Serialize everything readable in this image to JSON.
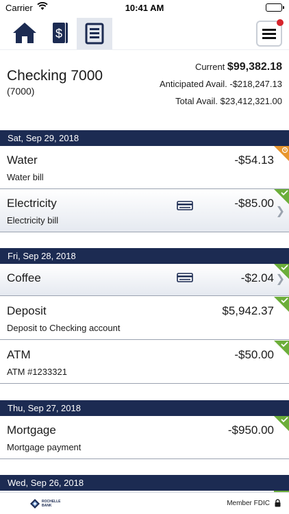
{
  "status_bar": {
    "carrier": "Carrier",
    "time": "10:41 AM"
  },
  "nav": {
    "tabs": [
      {
        "icon": "home-icon",
        "selected": false
      },
      {
        "icon": "money-icon",
        "selected": false
      },
      {
        "icon": "register-icon",
        "selected": true
      }
    ],
    "menu_icon": "menu-icon",
    "menu_has_notification": true
  },
  "account": {
    "name": "Checking 7000",
    "number": "(7000)",
    "current_label": "Current",
    "current_value": "$99,382.18",
    "anticipated": "Anticipated Avail. -$218,247.13",
    "total": "Total Avail. $23,412,321.00"
  },
  "dates": [
    "Sat, Sep 29, 2018",
    "Fri, Sep 28, 2018",
    "Thu, Sep 27, 2018",
    "Wed, Sep 26, 2018"
  ],
  "transactions": [
    {
      "title": "Water",
      "amount": "-$54.13",
      "description": "Water bill",
      "status": "pending"
    },
    {
      "title": "Electricity",
      "amount": "-$85.00",
      "description": "Electricity bill",
      "status": "cleared",
      "card": true
    },
    {
      "title": "Coffee",
      "amount": "-$2.04",
      "description": "",
      "status": "cleared",
      "card": true
    },
    {
      "title": "Deposit",
      "amount": "$5,942.37",
      "description": "Deposit to Checking account",
      "status": "cleared"
    },
    {
      "title": "ATM",
      "amount": "-$50.00",
      "description": "ATM #1233321",
      "status": "cleared"
    },
    {
      "title": "Mortgage",
      "amount": "-$950.00",
      "description": "Mortgage payment",
      "status": "cleared"
    }
  ],
  "colors": {
    "navy": "#1c2b52",
    "cleared": "#6cae3a",
    "pending": "#e8962e",
    "badge": "#d6242c"
  },
  "footer": {
    "logo_line1": "ROCHELLE",
    "logo_line2": "BANK",
    "fdic": "Member FDIC"
  }
}
